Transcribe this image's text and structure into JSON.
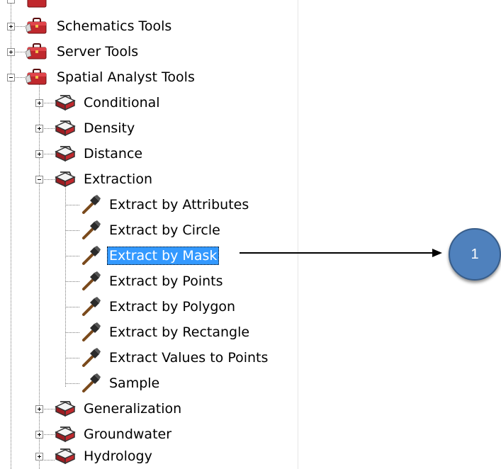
{
  "tree": {
    "toolboxes": [
      {
        "label": "Schematics Tools",
        "icon": "red-toolbox-icon",
        "state": "collapsed"
      },
      {
        "label": "Server Tools",
        "icon": "red-toolbox-icon",
        "state": "collapsed"
      },
      {
        "label": "Spatial Analyst Tools",
        "icon": "red-toolbox-icon",
        "state": "expanded"
      }
    ],
    "toolsets": [
      {
        "label": "Conditional",
        "state": "collapsed"
      },
      {
        "label": "Density",
        "state": "collapsed"
      },
      {
        "label": "Distance",
        "state": "collapsed"
      },
      {
        "label": "Extraction",
        "state": "expanded"
      },
      {
        "label": "Generalization",
        "state": "collapsed"
      },
      {
        "label": "Groundwater",
        "state": "collapsed"
      },
      {
        "label": "Hydrology",
        "state": "collapsed"
      }
    ],
    "tools": [
      {
        "label": "Extract by Attributes"
      },
      {
        "label": "Extract by Circle"
      },
      {
        "label": "Extract by Mask",
        "selected": true
      },
      {
        "label": "Extract by Points"
      },
      {
        "label": "Extract by Polygon"
      },
      {
        "label": "Extract by Rectangle"
      },
      {
        "label": "Extract Values to Points"
      },
      {
        "label": "Sample"
      }
    ]
  },
  "callout": {
    "label": "1",
    "color": "#4f81bd"
  },
  "colors": {
    "selection": "#3399ff",
    "toolbox": "#c0282d"
  }
}
